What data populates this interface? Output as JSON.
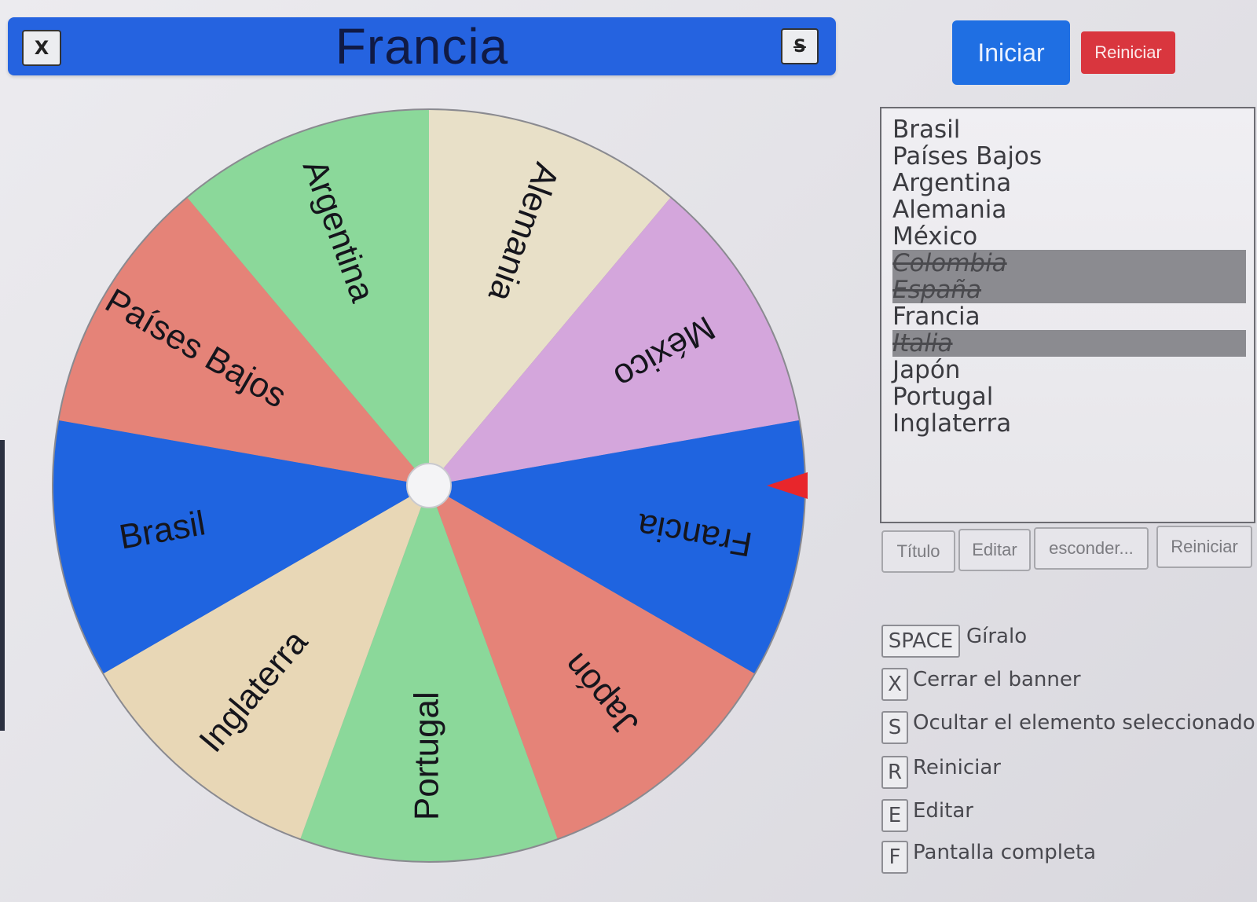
{
  "banner": {
    "title": "Francia",
    "close_label": "X",
    "hide_label": "S",
    "color": "#2563e0"
  },
  "buttons": {
    "start": "Iniciar",
    "reset": "Reiniciar"
  },
  "wheel": {
    "selected": "Francia",
    "pointer_color": "#e8262b",
    "segments": [
      {
        "label": "Alemania",
        "color": "#e8e0c8"
      },
      {
        "label": "México",
        "color": "#d4a6dc"
      },
      {
        "label": "Francia",
        "color": "#1f64e0"
      },
      {
        "label": "Japón",
        "color": "#e58378"
      },
      {
        "label": "Portugal",
        "color": "#8bd89a"
      },
      {
        "label": "Inglaterra",
        "color": "#e8d7b6"
      },
      {
        "label": "Brasil",
        "color": "#1f64e0"
      },
      {
        "label": "Países Bajos",
        "color": "#e58378"
      },
      {
        "label": "Argentina",
        "color": "#8bd89a"
      }
    ]
  },
  "entries": [
    {
      "label": "Brasil",
      "hidden": false
    },
    {
      "label": "Países Bajos",
      "hidden": false
    },
    {
      "label": "Argentina",
      "hidden": false
    },
    {
      "label": "Alemania",
      "hidden": false
    },
    {
      "label": "México",
      "hidden": false
    },
    {
      "label": "Colombia",
      "hidden": true
    },
    {
      "label": "España",
      "hidden": true
    },
    {
      "label": "Francia",
      "hidden": false
    },
    {
      "label": "Italia",
      "hidden": true
    },
    {
      "label": "Japón",
      "hidden": false
    },
    {
      "label": "Portugal",
      "hidden": false
    },
    {
      "label": "Inglaterra",
      "hidden": false
    }
  ],
  "panel_buttons": {
    "title": "Título",
    "edit": "Editar",
    "hide": "esconder...",
    "reset": "Reiniciar"
  },
  "shortcuts": [
    {
      "key": "SPACE",
      "desc": "Gíralo"
    },
    {
      "key": "X",
      "desc": "Cerrar el banner"
    },
    {
      "key": "S",
      "desc": "Ocultar el elemento seleccionado"
    },
    {
      "key": "R",
      "desc": "Reiniciar"
    },
    {
      "key": "E",
      "desc": "Editar"
    },
    {
      "key": "F",
      "desc": "Pantalla completa"
    }
  ]
}
